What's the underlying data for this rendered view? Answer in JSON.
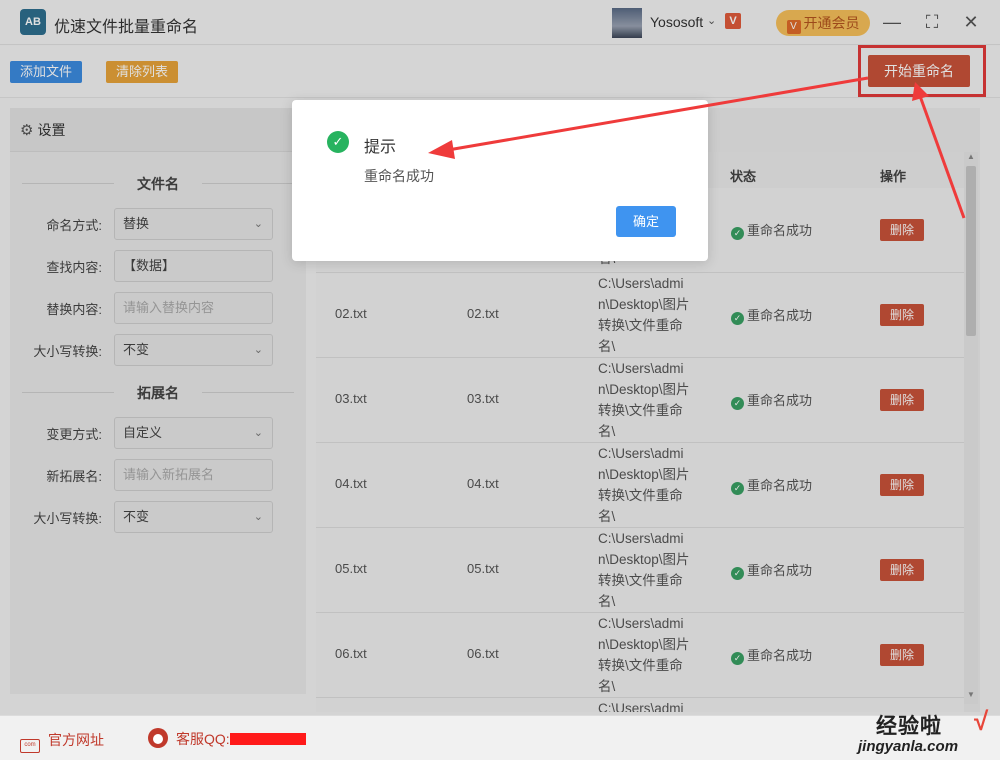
{
  "app": {
    "title": "优速文件批量重命名",
    "logo_text": "AB"
  },
  "user": {
    "name": "Yososoft",
    "chevron": "⌄",
    "vip_badge_text": "V"
  },
  "vip_button": {
    "icon": "V",
    "label": "开通会员"
  },
  "window_controls": {
    "minimize": "—",
    "maximize": "⛶",
    "close": "✕"
  },
  "toolbar": {
    "add_label": "添加文件",
    "clear_label": "清除列表",
    "start_label": "开始重命名"
  },
  "settings": {
    "header": "设置",
    "filename_section": "文件名",
    "extension_section": "拓展名",
    "fields": [
      {
        "label": "命名方式:",
        "value": "替换"
      },
      {
        "label": "查找内容:",
        "value": "【数据】"
      },
      {
        "label": "替换内容:",
        "placeholder": "请输入替换内容"
      },
      {
        "label": "大小写转换:",
        "value": "不变"
      },
      {
        "label": "变更方式:",
        "value": "自定义"
      },
      {
        "label": "新拓展名:",
        "placeholder": "请输入新拓展名"
      },
      {
        "label": "大小写转换:",
        "value": "不变"
      }
    ]
  },
  "table": {
    "columns": {
      "status": "状态",
      "action": "操作"
    },
    "status_text": "重命名成功",
    "delete_label": "删除",
    "partial_path_end": "名\\",
    "path_lines": [
      "C:\\Users\\admi",
      "n\\Desktop\\图片",
      "转换\\文件重命",
      "名\\"
    ],
    "rows": [
      {
        "original": "02.txt",
        "new": "02.txt"
      },
      {
        "original": "03.txt",
        "new": "03.txt"
      },
      {
        "original": "04.txt",
        "new": "04.txt"
      },
      {
        "original": "05.txt",
        "new": "05.txt"
      },
      {
        "original": "06.txt",
        "new": "06.txt"
      }
    ],
    "partial_last_path": "C:\\Users\\admi"
  },
  "dialog": {
    "title": "提示",
    "message": "重命名成功",
    "ok_label": "确定"
  },
  "footer": {
    "site_label": "官方网址",
    "site_icon_text": "com",
    "qq_label": "客服QQ:"
  },
  "watermark": {
    "text": "经验啦",
    "check": "√",
    "url": "jingyanla.com"
  },
  "colors": {
    "primary_blue": "#3c8be0",
    "clear_orange": "#e8a33a",
    "start_red": "#c9533a",
    "success_green": "#27b35f",
    "annotation_red": "#e23a3a"
  }
}
